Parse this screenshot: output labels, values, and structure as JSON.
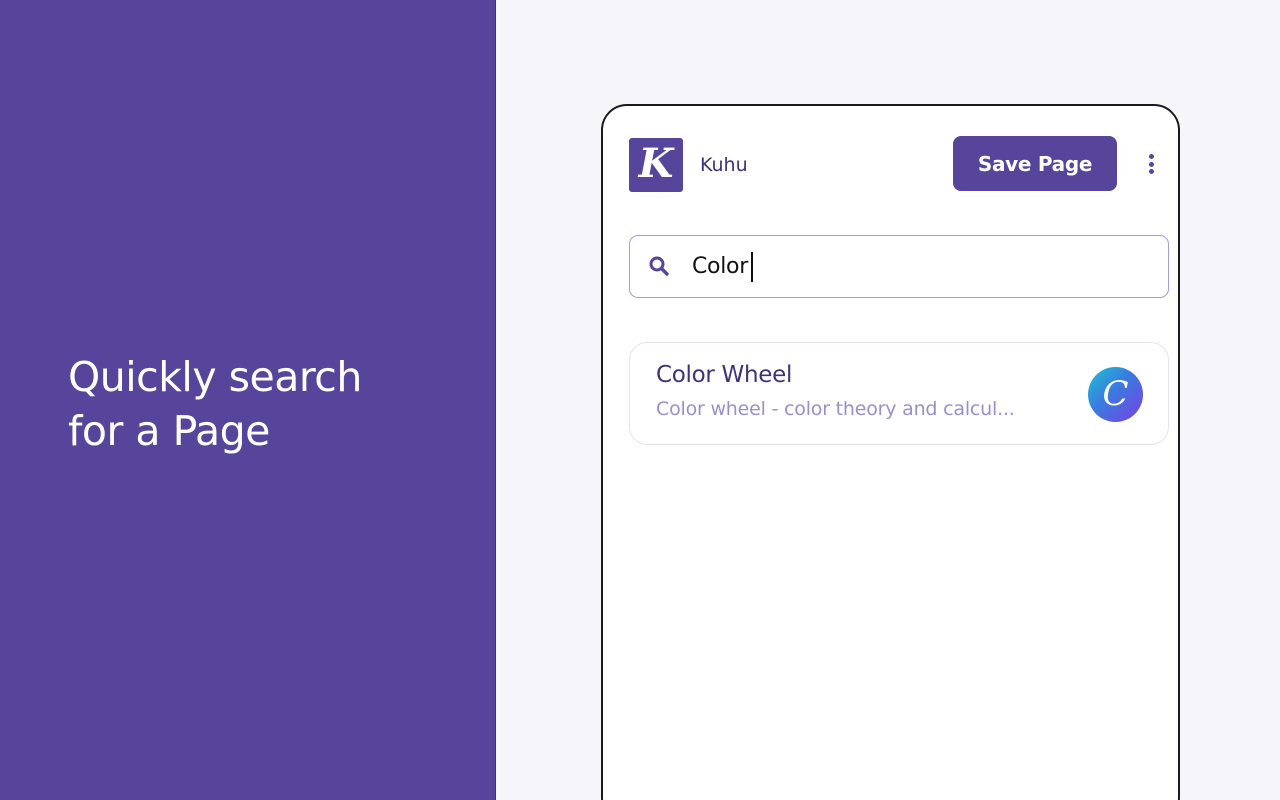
{
  "left": {
    "tagline": "Quickly search for a Page",
    "background_color": "#56459a"
  },
  "popup": {
    "logo_letter": "K",
    "brand_name": "Kuhu",
    "save_button_label": "Save Page",
    "menu_icon": "more-vertical-icon",
    "search": {
      "icon": "search-icon",
      "value": "Color"
    },
    "results": [
      {
        "title": "Color Wheel",
        "description": "Color wheel - color theory and calcul...",
        "favicon_letter": "C"
      }
    ]
  },
  "colors": {
    "brand": "#56459a",
    "search_border": "#a79ad6",
    "result_desc": "#9a8fcb"
  }
}
